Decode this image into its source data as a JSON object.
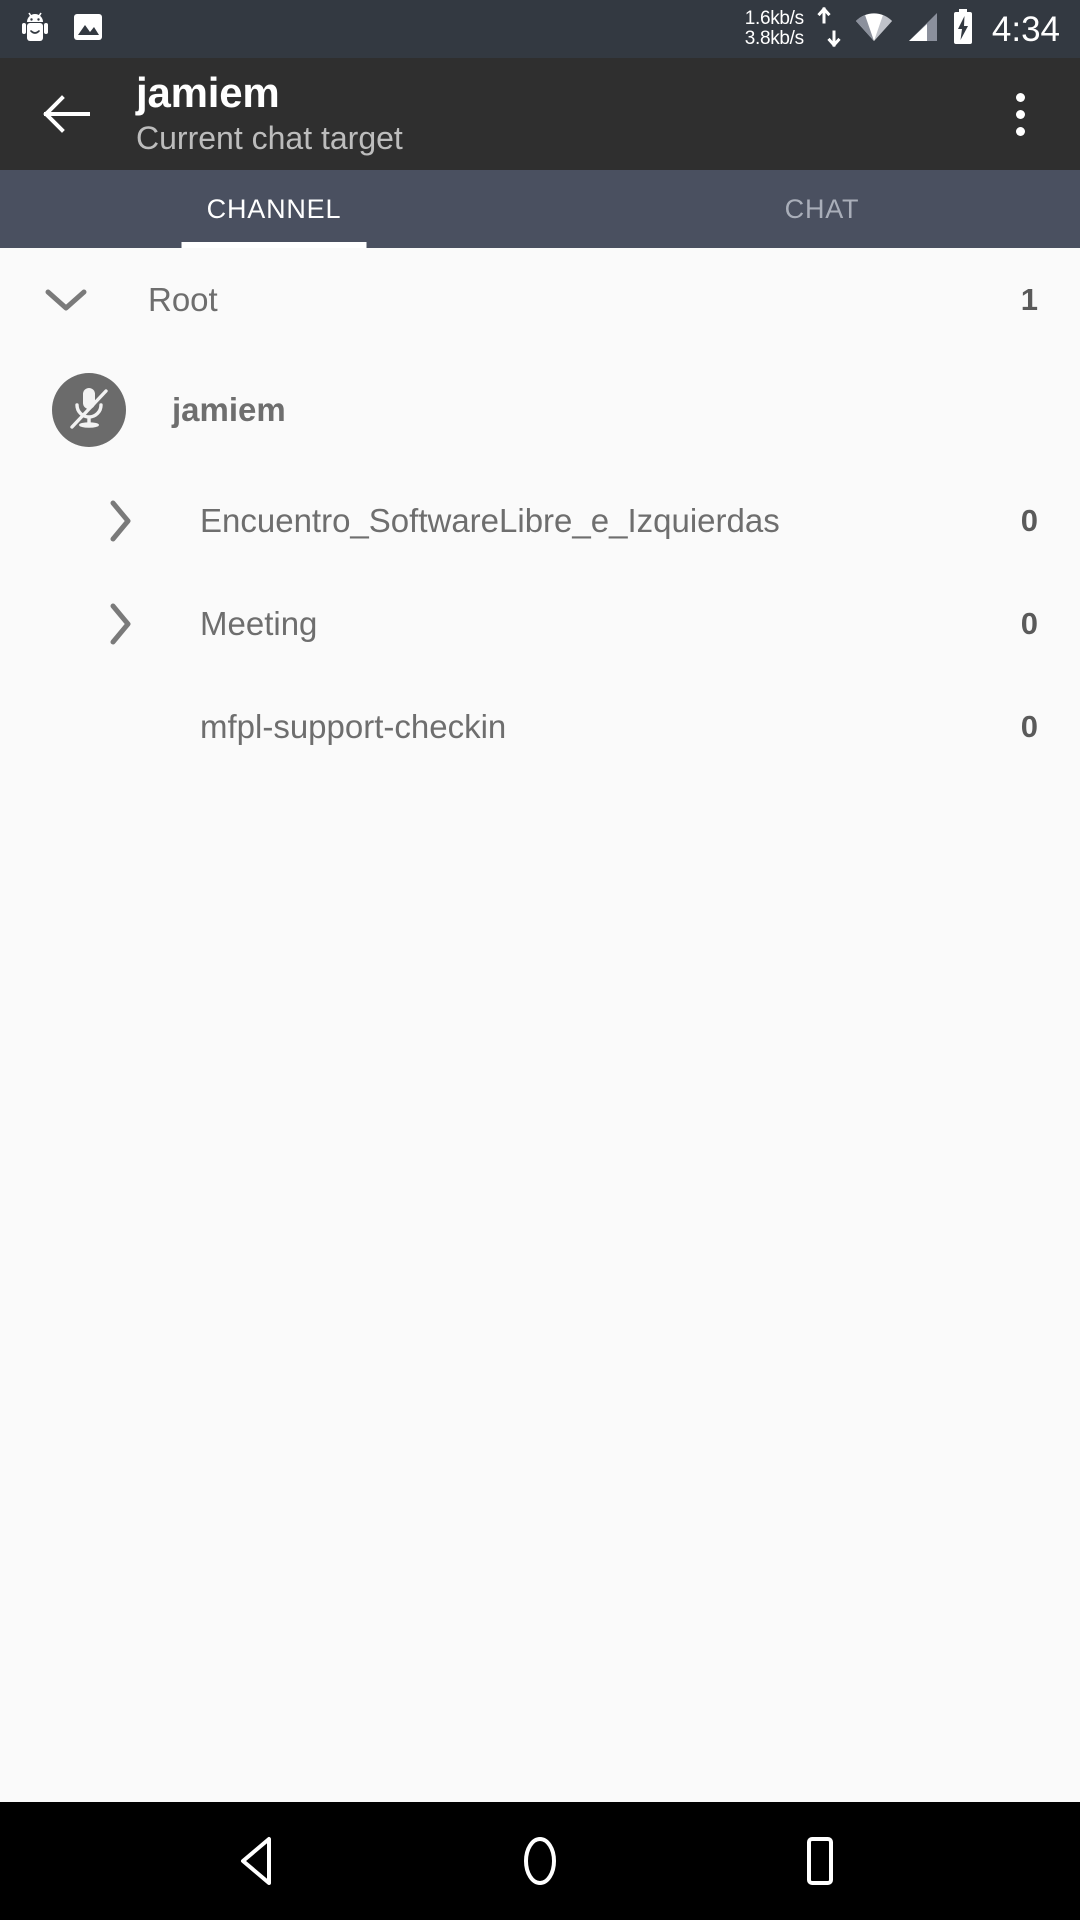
{
  "status_bar": {
    "icons": [
      "android-debug-icon",
      "gallery-icon"
    ],
    "net_up": "1.6kb/s",
    "net_down": "3.8kb/s",
    "wifi": "wifi-icon",
    "signal": "cell-signal-icon",
    "battery": "battery-charging-icon",
    "time": "4:34",
    "background": "#333941"
  },
  "app_bar": {
    "back_label": "back-arrow",
    "title": "jamiem",
    "subtitle": "Current chat target",
    "overflow_label": "more-options",
    "background": "#2f2f2f"
  },
  "tabs": {
    "active_index": 0,
    "items": [
      {
        "label": "CHANNEL"
      },
      {
        "label": "CHAT"
      }
    ],
    "background": "#4a5060",
    "indicator_color": "#ffffff"
  },
  "channel_tree": {
    "root": {
      "label": "Root",
      "count": "1",
      "expanded": true,
      "chevron": "chevron-down-icon"
    },
    "user": {
      "name": "jamiem",
      "avatar_icon": "microphone-muted-icon",
      "avatar_color": "#6b6b6b"
    },
    "channels": [
      {
        "label": "Encuentro_SoftwareLibre_e_Izquierdas",
        "count": "0",
        "chevron": "chevron-right-icon",
        "has_chevron": true
      },
      {
        "label": "Meeting",
        "count": "0",
        "chevron": "chevron-right-icon",
        "has_chevron": true
      },
      {
        "label": "mfpl-support-checkin",
        "count": "0",
        "chevron": "",
        "has_chevron": false
      }
    ]
  },
  "nav_bar": {
    "back": "nav-back-icon",
    "home": "nav-home-icon",
    "recents": "nav-recents-icon",
    "background": "#000000"
  }
}
